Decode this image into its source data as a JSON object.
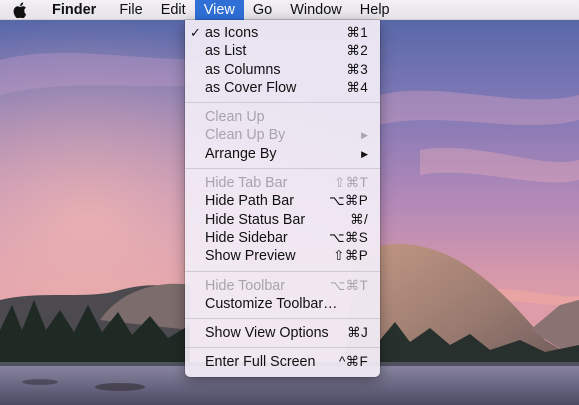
{
  "menubar": {
    "apple_icon": "apple-logo-icon",
    "items": [
      "Finder",
      "File",
      "Edit",
      "View",
      "Go",
      "Window",
      "Help"
    ],
    "active": "View"
  },
  "view_menu": {
    "sections": [
      [
        {
          "label": "as Icons",
          "shortcut": "⌘1",
          "checked": true,
          "enabled": true
        },
        {
          "label": "as List",
          "shortcut": "⌘2",
          "checked": false,
          "enabled": true
        },
        {
          "label": "as Columns",
          "shortcut": "⌘3",
          "checked": false,
          "enabled": true
        },
        {
          "label": "as Cover Flow",
          "shortcut": "⌘4",
          "checked": false,
          "enabled": true
        }
      ],
      [
        {
          "label": "Clean Up",
          "shortcut": "",
          "enabled": false
        },
        {
          "label": "Clean Up By",
          "submenu": true,
          "enabled": false
        },
        {
          "label": "Arrange By",
          "submenu": true,
          "enabled": true
        }
      ],
      [
        {
          "label": "Hide Tab Bar",
          "shortcut": "⇧⌘T",
          "enabled": false
        },
        {
          "label": "Hide Path Bar",
          "shortcut": "⌥⌘P",
          "enabled": true
        },
        {
          "label": "Hide Status Bar",
          "shortcut": "⌘/",
          "enabled": true
        },
        {
          "label": "Hide Sidebar",
          "shortcut": "⌥⌘S",
          "enabled": true
        },
        {
          "label": "Show Preview",
          "shortcut": "⇧⌘P",
          "enabled": true
        }
      ],
      [
        {
          "label": "Hide Toolbar",
          "shortcut": "⌥⌘T",
          "enabled": false
        },
        {
          "label": "Customize Toolbar…",
          "shortcut": "",
          "enabled": true
        }
      ],
      [
        {
          "label": "Show View Options",
          "shortcut": "⌘J",
          "enabled": true
        }
      ],
      [
        {
          "label": "Enter Full Screen",
          "shortcut": "^⌘F",
          "enabled": true
        }
      ]
    ]
  },
  "colors": {
    "highlight": "#2f6fd6",
    "disabled_text": "#a8a4ad"
  }
}
